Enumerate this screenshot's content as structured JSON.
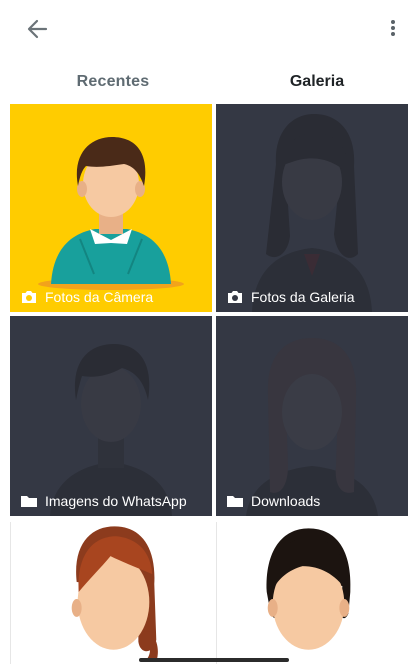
{
  "header": {
    "back_icon": "arrow-left-icon",
    "menu_icon": "more-vertical-icon"
  },
  "tabs": [
    {
      "label": "Recentes",
      "selected": false
    },
    {
      "label": "Galeria",
      "selected": true
    }
  ],
  "albums": [
    {
      "label": "Fotos da Câmera",
      "icon": "camera-icon",
      "background": "#FFCC00"
    },
    {
      "label": "Fotos da Galeria",
      "icon": "camera-icon",
      "background": "#343844"
    },
    {
      "label": "Imagens do WhatsApp",
      "icon": "folder-icon",
      "background": "#343844"
    },
    {
      "label": "Downloads",
      "icon": "folder-icon",
      "background": "#343844"
    }
  ],
  "colors": {
    "accent_yellow": "#FFCC00",
    "tile_dark": "#343844",
    "text_dark": "#1F2326",
    "text_muted": "#5F6B72"
  }
}
